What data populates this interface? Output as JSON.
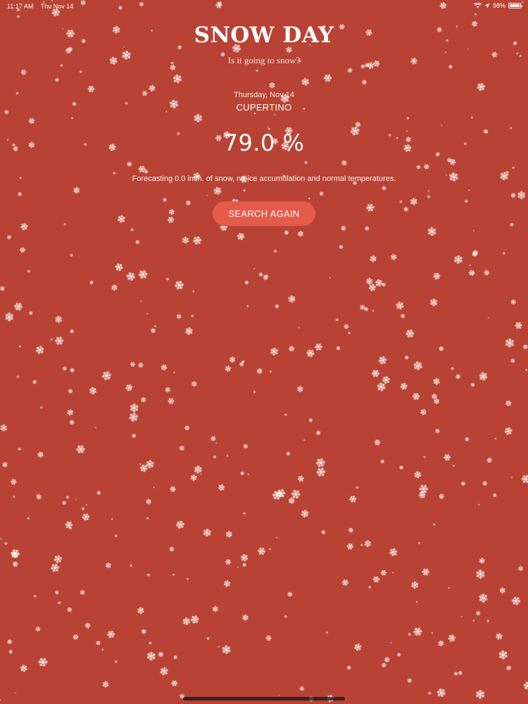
{
  "status_bar": {
    "time": "11:17 AM",
    "date": "Thu Nov 14",
    "battery": "98%",
    "battery_level": 0.98,
    "icons": [
      "wifi-icon",
      "location-icon",
      "battery-icon"
    ]
  },
  "app": {
    "title": "SNOW DAY",
    "subtitle": "Is it going to snow?"
  },
  "forecast": {
    "date": "Thursday, Nov 14",
    "city": "CUPERTINO",
    "probability": "79.0 %",
    "summary": "Forecasting 0.0 inch. of snow, no ice accumulation and normal temperatures."
  },
  "actions": {
    "search_again_label": "SEARCH AGAIN"
  },
  "colors": {
    "background": "#b84233",
    "button": "#e55a4a",
    "text": "#ffffff"
  }
}
